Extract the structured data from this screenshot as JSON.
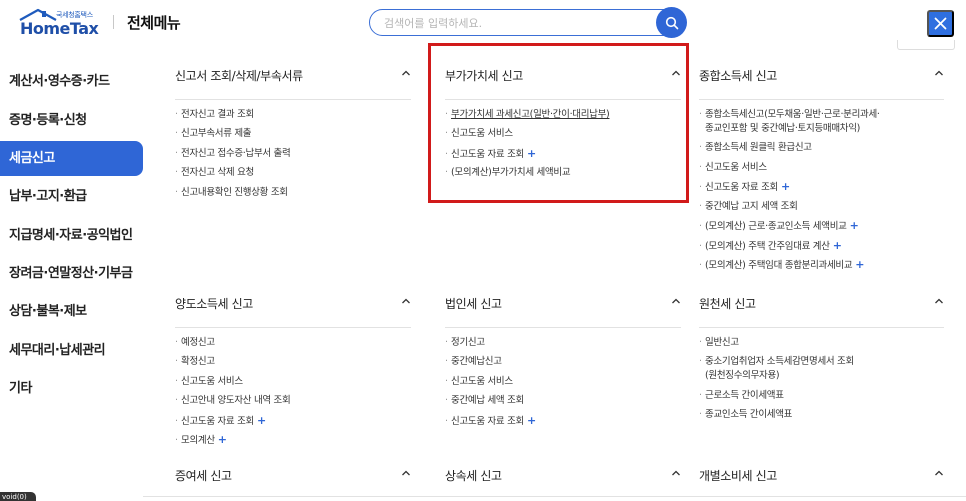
{
  "header": {
    "logo_small": "국세청홈택스",
    "logo_main": "HomeTax",
    "menu_title": "전체메뉴",
    "search_placeholder": "검색어를 입력하세요."
  },
  "sidebar": {
    "items": [
      {
        "label": "계산서·영수증·카드",
        "active": false
      },
      {
        "label": "증명·등록·신청",
        "active": false
      },
      {
        "label": "세금신고",
        "active": true
      },
      {
        "label": "납부·고지·환급",
        "active": false
      },
      {
        "label": "지급명세·자료·공익법인",
        "active": false
      },
      {
        "label": "장려금·연말정산·기부금",
        "active": false
      },
      {
        "label": "상담·불복·제보",
        "active": false
      },
      {
        "label": "세무대리·납세관리",
        "active": false
      },
      {
        "label": "기타",
        "active": false
      }
    ]
  },
  "sections": {
    "s1": {
      "title": "신고서 조회/삭제/부속서류",
      "items": [
        {
          "label": "전자신고 결과 조회"
        },
        {
          "label": "신고부속서류 제출"
        },
        {
          "label": "전자신고 접수증·납부서 출력"
        },
        {
          "label": "전자신고 삭제 요청"
        },
        {
          "label": "신고내용확인 진행상황 조회"
        }
      ]
    },
    "s2": {
      "title": "부가가치세 신고",
      "items": [
        {
          "label": "부가가치세 과세신고(일반·간이·대리납부)"
        },
        {
          "label": "신고도움 서비스"
        },
        {
          "label": "신고도움 자료 조회"
        },
        {
          "label": "(모의계산)부가가치세 세액비교"
        }
      ]
    },
    "s3": {
      "title": "종합소득세 신고",
      "items": [
        {
          "label": "종합소득세신고(모두채움·일반·근로·분리과세·"
        },
        {
          "label": "종교인포함 및 중간예납·토지등매매차익)"
        },
        {
          "label": "종합소득세 원클릭 환급신고"
        },
        {
          "label": "신고도움 서비스"
        },
        {
          "label": "신고도움 자료 조회"
        },
        {
          "label": "중간예납 고지 세액 조회"
        },
        {
          "label": "(모의계산) 근로·종교인소득 세액비교"
        },
        {
          "label": "(모의계산) 주택 간주임대료 계산"
        },
        {
          "label": "(모의계산) 주택임대 종합분리과세비교"
        }
      ]
    },
    "s4": {
      "title": "양도소득세 신고",
      "items": [
        {
          "label": "예정신고"
        },
        {
          "label": "확정신고"
        },
        {
          "label": "신고도움 서비스"
        },
        {
          "label": "신고안내 양도자산 내역 조회"
        },
        {
          "label": "신고도움 자료 조회"
        },
        {
          "label": "모의계산"
        }
      ]
    },
    "s5": {
      "title": "법인세 신고",
      "items": [
        {
          "label": "정기신고"
        },
        {
          "label": "중간예납신고"
        },
        {
          "label": "신고도움 서비스"
        },
        {
          "label": "중간예납 세액 조회"
        },
        {
          "label": "신고도움 자료 조회"
        }
      ]
    },
    "s6": {
      "title": "원천세 신고",
      "items": [
        {
          "label": "일반신고"
        },
        {
          "label": "중소기업취업자 소득세감면명세서 조회"
        },
        {
          "label": "(원천징수의무자용)"
        },
        {
          "label": "근로소득 간이세액표"
        },
        {
          "label": "종교인소득 간이세액표"
        }
      ]
    },
    "s7": {
      "title": "증여세 신고"
    },
    "s8": {
      "title": "상속세 신고"
    },
    "s9": {
      "title": "개별소비세 신고"
    }
  },
  "status": {
    "text": "void(0)"
  },
  "colors": {
    "accent": "#2f66d6",
    "highlight": "#d11a1a"
  }
}
